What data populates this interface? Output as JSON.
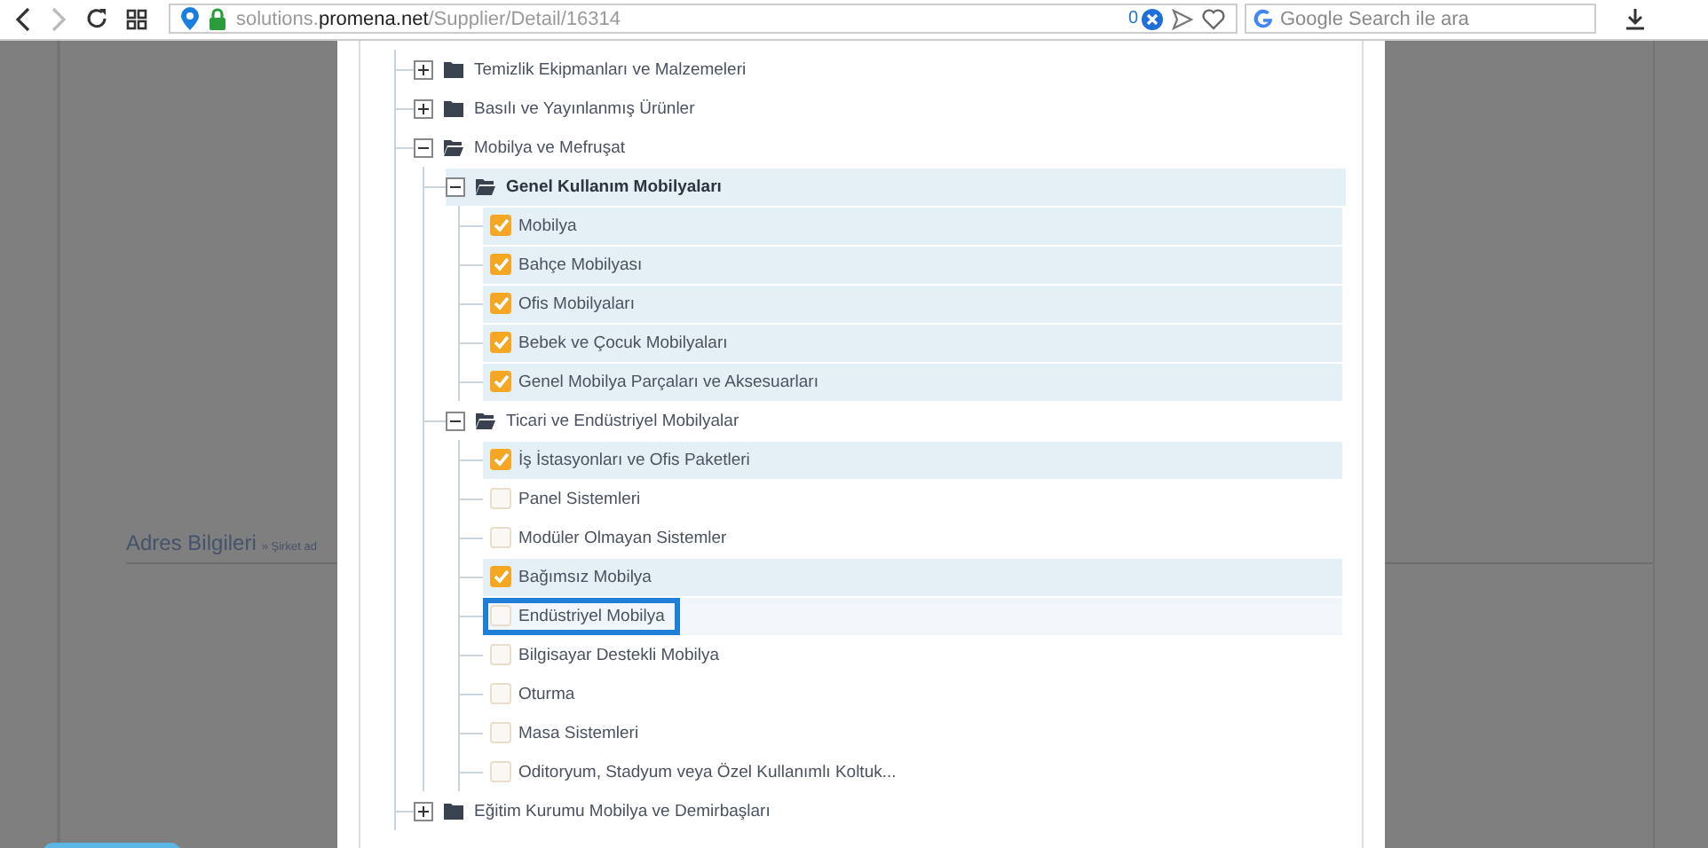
{
  "browser": {
    "url": "solutions.**promena.net**/Supplier/Detail/16314",
    "badge": "0",
    "search": {
      "placeholder": "Google Search ile ara"
    }
  },
  "page": {
    "section_title": "Adres Bilgileri",
    "breadcrumb": "» Şirket ad"
  },
  "tree": [
    {
      "label": "Temizlik Ekipmanları ve Malzemeleri",
      "expanded": false
    },
    {
      "label": "Basılı ve Yayınlanmış Ürünler",
      "expanded": false
    },
    {
      "label": "Mobilya ve Mefruşat",
      "expanded": true,
      "children": [
        {
          "label": "Genel Kullanım Mobilyaları",
          "expanded": true,
          "selected": true,
          "children": [
            {
              "label": "Mobilya",
              "checked": true,
              "focused": false
            },
            {
              "label": "Bahçe Mobilyası",
              "checked": true,
              "focused": false
            },
            {
              "label": "Ofis Mobilyaları",
              "checked": true,
              "focused": false
            },
            {
              "label": "Bebek ve Çocuk Mobilyaları",
              "checked": true,
              "focused": false
            },
            {
              "label": "Genel Mobilya Parçaları ve Aksesuarları",
              "checked": true,
              "focused": false
            }
          ]
        },
        {
          "label": "Ticari ve Endüstriyel Mobilyalar",
          "expanded": true,
          "selected": false,
          "children": [
            {
              "label": "İş İstasyonları ve Ofis Paketleri",
              "checked": true,
              "focused": false
            },
            {
              "label": "Panel Sistemleri",
              "checked": false,
              "focused": false
            },
            {
              "label": "Modüler Olmayan Sistemler",
              "checked": false,
              "focused": false
            },
            {
              "label": "Bağımsız Mobilya",
              "checked": true,
              "focused": false
            },
            {
              "label": "Endüstriyel Mobilya",
              "checked": false,
              "focused": true
            },
            {
              "label": "Bilgisayar Destekli Mobilya",
              "checked": false,
              "focused": false
            },
            {
              "label": "Oturma",
              "checked": false,
              "focused": false
            },
            {
              "label": "Masa Sistemleri",
              "checked": false,
              "focused": false
            },
            {
              "label": "Oditoryum, Stadyum veya Özel Kullanımlı Koltuk...",
              "checked": false,
              "focused": false
            }
          ]
        }
      ]
    },
    {
      "label": "Eğitim Kurumu Mobilya ve Demirbaşları",
      "expanded": false
    }
  ]
}
